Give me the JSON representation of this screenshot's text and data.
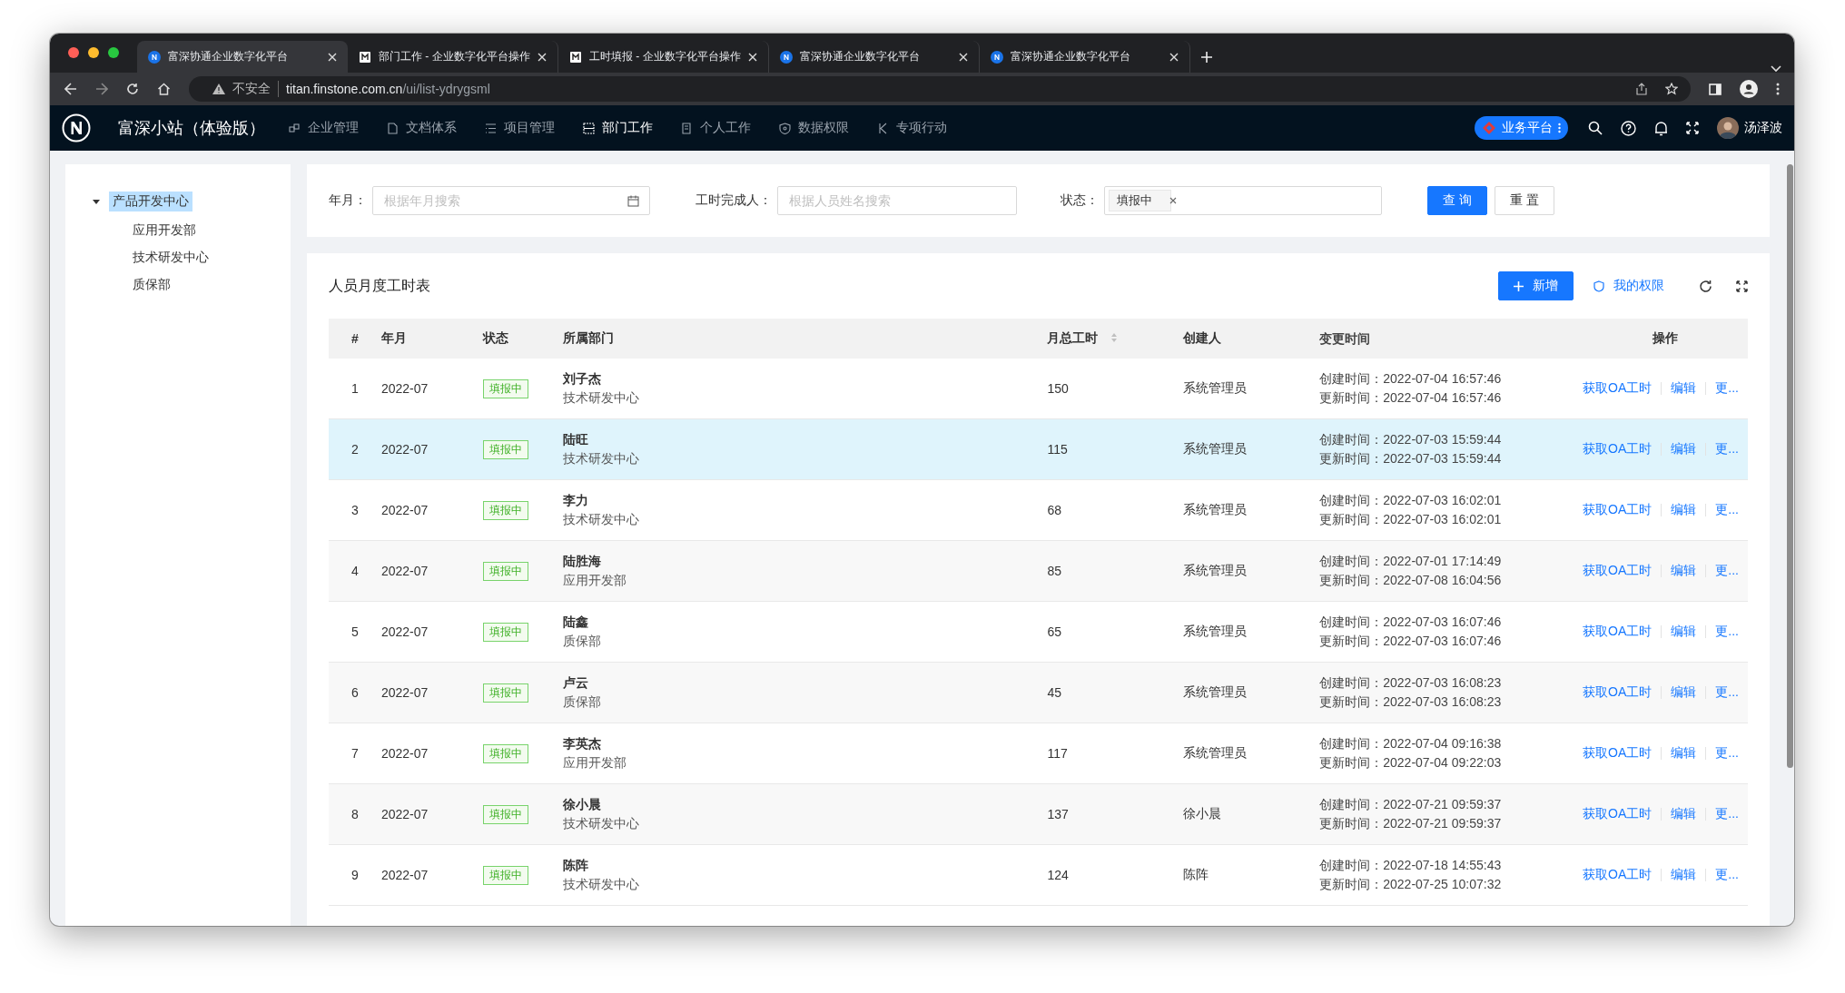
{
  "browser": {
    "tabs": [
      {
        "title": "富深协通企业数字化平台",
        "kind": "app",
        "selected": true
      },
      {
        "title": "部门工作 - 企业数字化平台操作",
        "kind": "doc",
        "selected": false
      },
      {
        "title": "工时填报 - 企业数字化平台操作",
        "kind": "doc",
        "selected": false
      },
      {
        "title": "富深协通企业数字化平台",
        "kind": "app",
        "selected": false
      },
      {
        "title": "富深协通企业数字化平台",
        "kind": "app",
        "selected": false
      }
    ],
    "security": "不安全",
    "host": "titan.finstone.com.cn",
    "path": "/ui/list-ydrygsml"
  },
  "app": {
    "brand": "富深小站（体验版）",
    "nav": [
      {
        "label": "企业管理",
        "selected": false
      },
      {
        "label": "文档体系",
        "selected": false
      },
      {
        "label": "项目管理",
        "selected": false
      },
      {
        "label": "部门工作",
        "selected": true
      },
      {
        "label": "个人工作",
        "selected": false
      },
      {
        "label": "数据权限",
        "selected": false
      },
      {
        "label": "专项行动",
        "selected": false
      }
    ],
    "platform": "业务平台",
    "user": "汤泽波"
  },
  "sidebar": {
    "tree": [
      {
        "label": "产品开发中心",
        "expanded": true,
        "selected": true,
        "children": [
          {
            "label": "应用开发部",
            "selected": false
          },
          {
            "label": "技术研发中心",
            "selected": false
          },
          {
            "label": "质保部",
            "selected": false
          }
        ]
      }
    ]
  },
  "filters": [
    {
      "kind": "date",
      "label": "年月：",
      "placeholder": "根据年月搜索"
    },
    {
      "kind": "text",
      "label": "工时完成人：",
      "placeholder": "根据人员姓名搜索"
    },
    {
      "kind": "tags",
      "label": "状态：",
      "tags": [
        "填报中"
      ]
    }
  ],
  "filter_buttons": {
    "query": "查 询",
    "reset": "重 置"
  },
  "table": {
    "title": "人员月度工时表",
    "add": "新增",
    "permission": "我的权限",
    "columns": [
      {
        "label": "#",
        "sortable": false
      },
      {
        "label": "年月",
        "sortable": false
      },
      {
        "label": "状态",
        "sortable": false
      },
      {
        "label": "所属部门",
        "sortable": false
      },
      {
        "label": "月总工时",
        "sortable": true
      },
      {
        "label": "创建人",
        "sortable": false
      },
      {
        "label": "变更时间",
        "sortable": false
      },
      {
        "label": "操作",
        "sortable": false
      }
    ],
    "rows": [
      {
        "index": "1",
        "month": "2022-07",
        "status": "填报中",
        "name": "刘子杰",
        "dept": "技术研发中心",
        "hours": "150",
        "creator": "系统管理员",
        "created": "创建时间：2022-07-04 16:57:46",
        "updated": "更新时间：2022-07-04 16:57:46",
        "actions": [
          "获取OA工时",
          "编辑",
          "更..."
        ],
        "selected": false
      },
      {
        "index": "2",
        "month": "2022-07",
        "status": "填报中",
        "name": "陆旺",
        "dept": "技术研发中心",
        "hours": "115",
        "creator": "系统管理员",
        "created": "创建时间：2022-07-03 15:59:44",
        "updated": "更新时间：2022-07-03 15:59:44",
        "actions": [
          "获取OA工时",
          "编辑",
          "更..."
        ],
        "selected": true
      },
      {
        "index": "3",
        "month": "2022-07",
        "status": "填报中",
        "name": "李力",
        "dept": "技术研发中心",
        "hours": "68",
        "creator": "系统管理员",
        "created": "创建时间：2022-07-03 16:02:01",
        "updated": "更新时间：2022-07-03 16:02:01",
        "actions": [
          "获取OA工时",
          "编辑",
          "更..."
        ],
        "selected": false
      },
      {
        "index": "4",
        "month": "2022-07",
        "status": "填报中",
        "name": "陆胜海",
        "dept": "应用开发部",
        "hours": "85",
        "creator": "系统管理员",
        "created": "创建时间：2022-07-01 17:14:49",
        "updated": "更新时间：2022-07-08 16:04:56",
        "actions": [
          "获取OA工时",
          "编辑",
          "更..."
        ],
        "selected": false
      },
      {
        "index": "5",
        "month": "2022-07",
        "status": "填报中",
        "name": "陆鑫",
        "dept": "质保部",
        "hours": "65",
        "creator": "系统管理员",
        "created": "创建时间：2022-07-03 16:07:46",
        "updated": "更新时间：2022-07-03 16:07:46",
        "actions": [
          "获取OA工时",
          "编辑",
          "更..."
        ],
        "selected": false
      },
      {
        "index": "6",
        "month": "2022-07",
        "status": "填报中",
        "name": "卢云",
        "dept": "质保部",
        "hours": "45",
        "creator": "系统管理员",
        "created": "创建时间：2022-07-03 16:08:23",
        "updated": "更新时间：2022-07-03 16:08:23",
        "actions": [
          "获取OA工时",
          "编辑",
          "更..."
        ],
        "selected": false
      },
      {
        "index": "7",
        "month": "2022-07",
        "status": "填报中",
        "name": "李英杰",
        "dept": "应用开发部",
        "hours": "117",
        "creator": "系统管理员",
        "created": "创建时间：2022-07-04 09:16:38",
        "updated": "更新时间：2022-07-04 09:22:03",
        "actions": [
          "获取OA工时",
          "编辑",
          "更..."
        ],
        "selected": false
      },
      {
        "index": "8",
        "month": "2022-07",
        "status": "填报中",
        "name": "徐小晨",
        "dept": "技术研发中心",
        "hours": "137",
        "creator": "徐小晨",
        "created": "创建时间：2022-07-21 09:59:37",
        "updated": "更新时间：2022-07-21 09:59:37",
        "actions": [
          "获取OA工时",
          "编辑",
          "更..."
        ],
        "selected": false
      },
      {
        "index": "9",
        "month": "2022-07",
        "status": "填报中",
        "name": "陈阵",
        "dept": "技术研发中心",
        "hours": "124",
        "creator": "陈阵",
        "created": "创建时间：2022-07-18 14:55:43",
        "updated": "更新时间：2022-07-25 10:07:32",
        "actions": [
          "获取OA工时",
          "编辑",
          "更..."
        ],
        "selected": false
      }
    ]
  }
}
